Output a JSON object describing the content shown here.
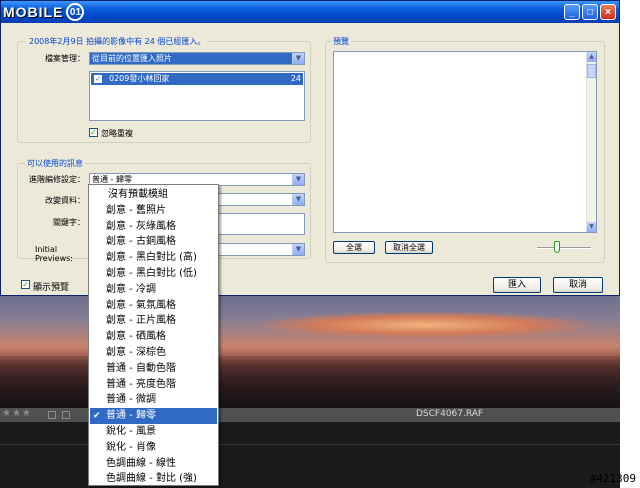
{
  "window": {
    "logo_text": "MOBILE",
    "logo_mark": "01",
    "buttons": {
      "min": "_",
      "max": "□",
      "close": "×"
    }
  },
  "import_group": {
    "legend": "2008年2月9日 拍攝的影像中有 24 個已經匯入。",
    "file_mgmt_label": "檔案管理：",
    "file_mgmt_value": "從目前的位置匯入照片",
    "folder_list": [
      {
        "name": "0209發小林回家",
        "count": "24",
        "checked": true
      }
    ],
    "ignore_dup_label": "忽略重複"
  },
  "info_group": {
    "legend": "可以使用的訊息",
    "develop_label": "進階編修設定：",
    "develop_value": "普通 - 歸零",
    "metadata_label": "改變資料：",
    "keywords_label": "關鍵字：",
    "initial_previews_label": "Initial Previews:"
  },
  "show_preview_label": "顯示預覽",
  "preview_group": {
    "legend": "預覽",
    "select_all": "全選",
    "deselect_all": "取消全選"
  },
  "actions": {
    "import": "匯入",
    "cancel": "取消"
  },
  "background": {
    "filename": "DSCF4067.RAF",
    "stars": "★★★"
  },
  "watermark": "#421309",
  "menu": {
    "selected_index": 14,
    "items": [
      "沒有預載模組",
      "創意 - 舊照片",
      "創意 - 灰綠風格",
      "創意 - 古銅風格",
      "創意 - 黑白對比 (高)",
      "創意 - 黑白對比 (低)",
      "創意 - 冷調",
      "創意 - 氣氛風格",
      "創意 - 正片風格",
      "創意 - 硒風格",
      "創意 - 深棕色",
      "普通 - 自動色階",
      "普通 - 亮度色階",
      "普通 - 微調",
      "普通 - 歸零",
      "銳化 - 風景",
      "銳化 - 肖像",
      "色調曲線 - 線性",
      "色調曲線 - 對比 (強)"
    ]
  }
}
